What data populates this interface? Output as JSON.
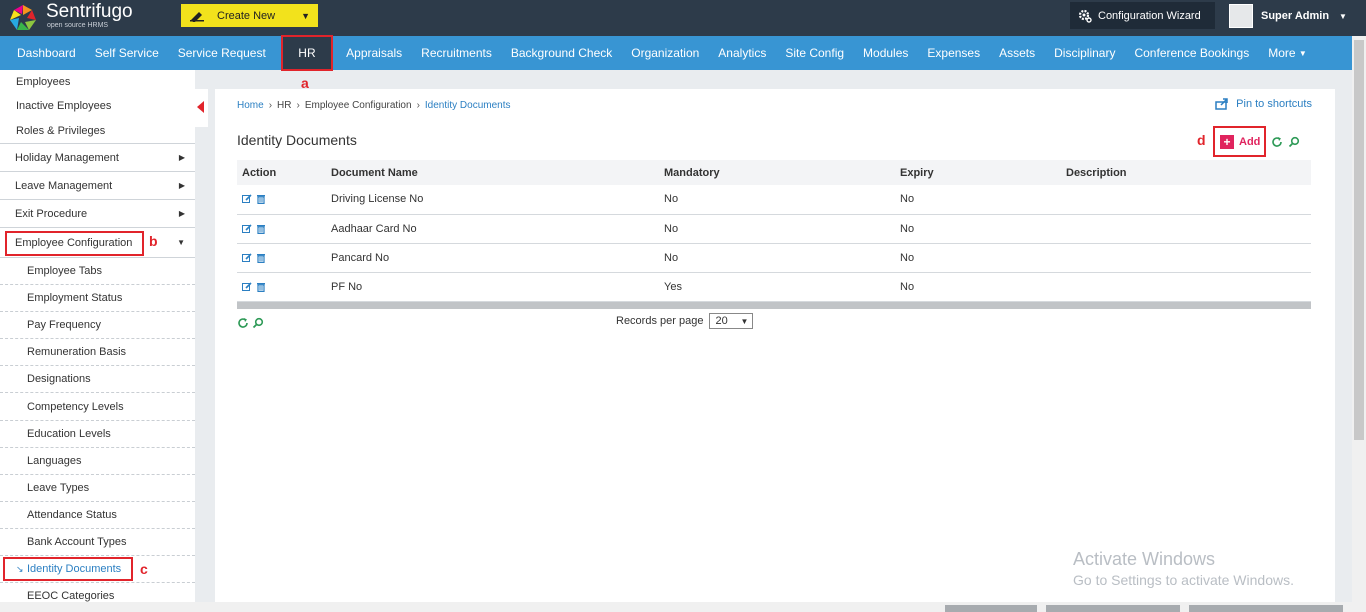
{
  "app": {
    "logo_title": "Sentrifugo",
    "logo_subtitle": "open source HRMS",
    "create_new_label": "Create New",
    "config_wizard_label": "Configuration Wizard",
    "user_name": "Super Admin"
  },
  "nav": {
    "items": [
      "Dashboard",
      "Self Service",
      "Service Request",
      "HR",
      "Appraisals",
      "Recruitments",
      "Background Check",
      "Organization",
      "Analytics",
      "Site Config",
      "Modules",
      "Expenses",
      "Assets",
      "Disciplinary",
      "Conference Bookings",
      "More"
    ],
    "active": "HR"
  },
  "annotations": {
    "a": "a",
    "b": "b",
    "c": "c",
    "d": "d"
  },
  "sidebar": {
    "top_items": [
      "Employees",
      "Inactive Employees",
      "Roles & Privileges"
    ],
    "menus": [
      "Holiday Management",
      "Leave Management",
      "Exit Procedure",
      "Employee Configuration"
    ],
    "sub_items": [
      "Employee Tabs",
      "Employment Status",
      "Pay Frequency",
      "Remuneration Basis",
      "Designations",
      "Competency Levels",
      "Education Levels",
      "Languages",
      "Leave Types",
      "Attendance Status",
      "Bank Account Types",
      "Identity Documents",
      "EEOC Categories"
    ],
    "active_sub": "Identity Documents"
  },
  "breadcrumb": {
    "home": "Home",
    "hr": "HR",
    "section": "Employee Configuration",
    "current": "Identity Documents"
  },
  "page": {
    "title": "Identity Documents",
    "pin_label": "Pin to shortcuts",
    "add_label": "Add"
  },
  "table": {
    "headers": [
      "Action",
      "Document Name",
      "Mandatory",
      "Expiry",
      "Description"
    ],
    "rows": [
      {
        "doc": "Driving License No",
        "mandatory": "No",
        "expiry": "No",
        "description": ""
      },
      {
        "doc": "Aadhaar Card No",
        "mandatory": "No",
        "expiry": "No",
        "description": ""
      },
      {
        "doc": "Pancard No",
        "mandatory": "No",
        "expiry": "No",
        "description": ""
      },
      {
        "doc": "PF No",
        "mandatory": "Yes",
        "expiry": "No",
        "description": ""
      }
    ]
  },
  "pagination": {
    "records_label": "Records per page",
    "records_value": "20"
  },
  "watermark": {
    "line1": "Activate Windows",
    "line2": "Go to Settings to activate Windows."
  },
  "colors": {
    "topbar": "#2d3b4a",
    "nav": "#3895d3",
    "accent": "#e0245e",
    "highlight": "#e1242b",
    "link": "#2b7fc2"
  }
}
